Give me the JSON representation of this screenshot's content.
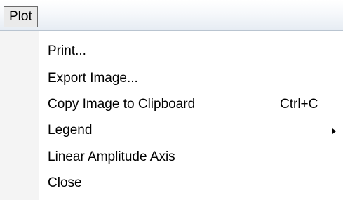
{
  "menubar": {
    "menu_title": "Plot"
  },
  "menu": {
    "items": [
      {
        "label": "Print..."
      },
      {
        "label": "Export Image..."
      },
      {
        "label": "Copy Image to Clipboard",
        "shortcut": "Ctrl+C"
      },
      {
        "label": "Legend",
        "submenu_icon": "submenu-arrow-icon"
      },
      {
        "label": "Linear Amplitude Axis"
      },
      {
        "label": "Close"
      }
    ]
  }
}
